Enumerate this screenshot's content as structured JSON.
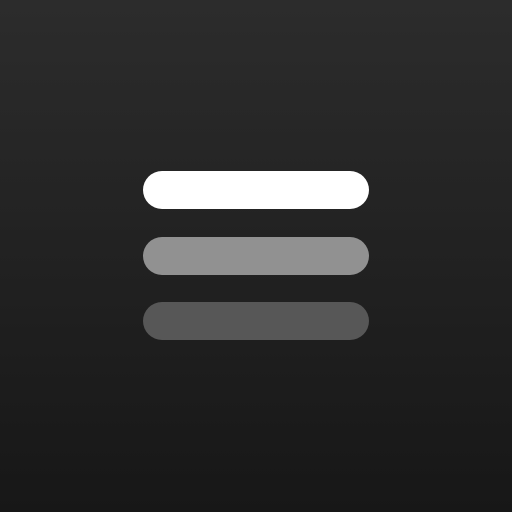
{
  "icon": {
    "name": "menu-icon",
    "bar_colors": [
      "#ffffff",
      "#919191",
      "#575757"
    ],
    "background_top": "#2c2c2c",
    "background_bottom": "#171717"
  }
}
